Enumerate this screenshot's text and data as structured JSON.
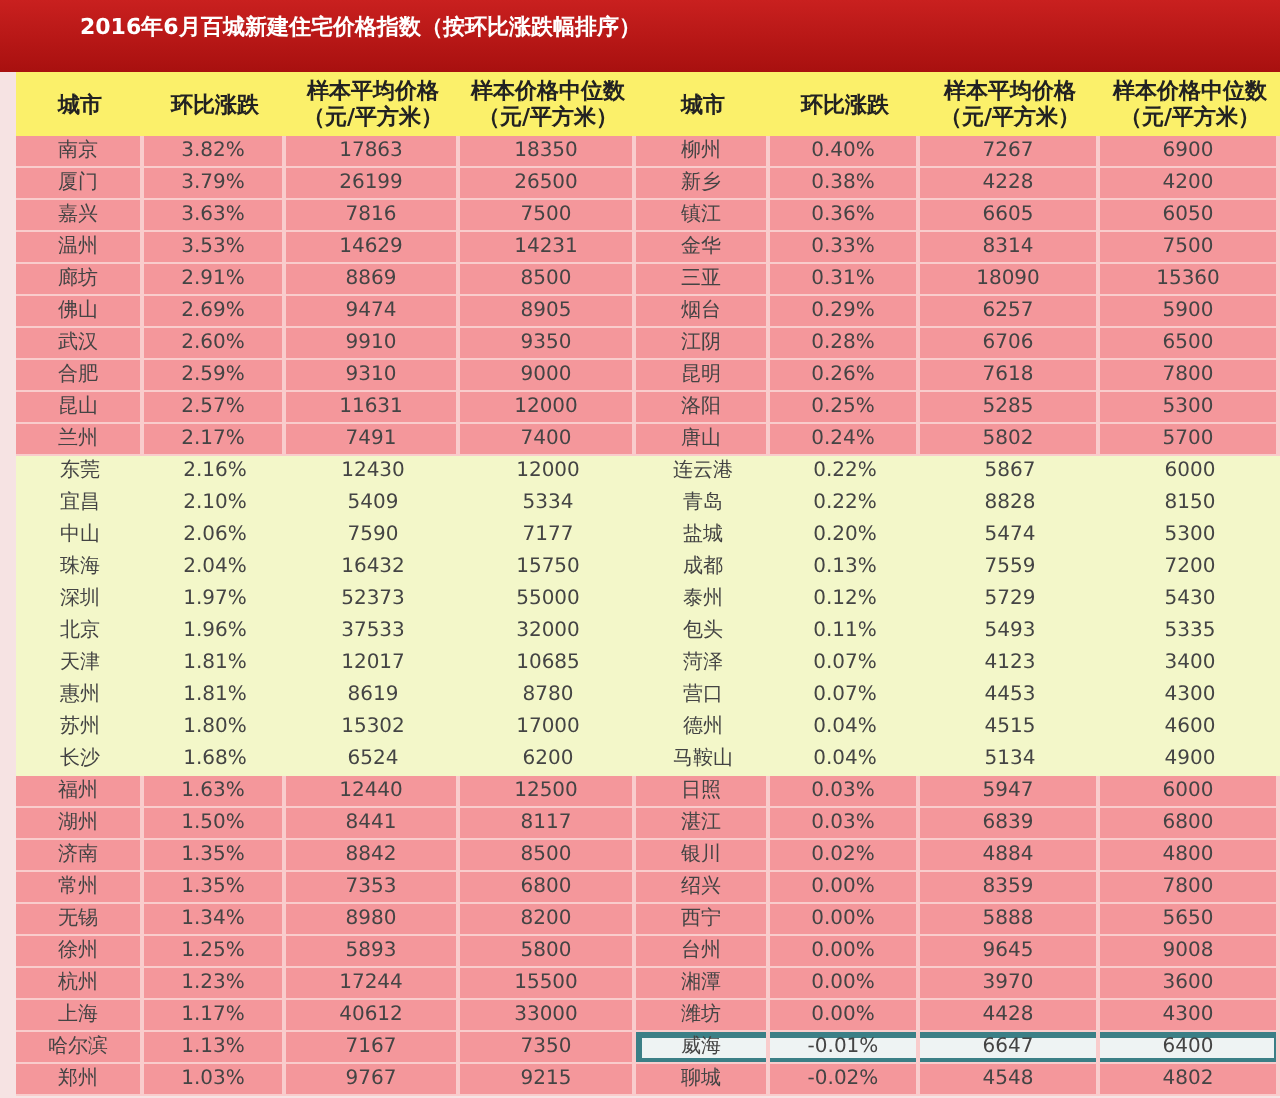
{
  "title": "2016年6月百城新建住宅价格指数（按环比涨跌幅排序）",
  "table": {
    "columns": [
      {
        "label": "城市"
      },
      {
        "label": "环比涨跌"
      },
      {
        "label": "样本平均价格",
        "unit": "（元/平方米）"
      },
      {
        "label": "样本价格中位数",
        "unit": "（元/平方米）"
      },
      {
        "label": "城市"
      },
      {
        "label": "环比涨跌"
      },
      {
        "label": "样本平均价格",
        "unit": "（元/平方米）"
      },
      {
        "label": "样本价格中位数",
        "unit": "（元/平方米）"
      }
    ],
    "rows": [
      {
        "kind": "highlight",
        "left": {
          "selected": false,
          "cells": [
            "南京",
            "3.82%",
            "17863",
            "18350"
          ]
        },
        "right": {
          "selected": false,
          "cells": [
            "柳州",
            "0.40%",
            "7267",
            "6900"
          ]
        }
      },
      {
        "kind": "highlight",
        "left": {
          "selected": false,
          "cells": [
            "厦门",
            "3.79%",
            "26199",
            "26500"
          ]
        },
        "right": {
          "selected": false,
          "cells": [
            "新乡",
            "0.38%",
            "4228",
            "4200"
          ]
        }
      },
      {
        "kind": "highlight",
        "left": {
          "selected": false,
          "cells": [
            "嘉兴",
            "3.63%",
            "7816",
            "7500"
          ]
        },
        "right": {
          "selected": false,
          "cells": [
            "镇江",
            "0.36%",
            "6605",
            "6050"
          ]
        }
      },
      {
        "kind": "highlight",
        "left": {
          "selected": false,
          "cells": [
            "温州",
            "3.53%",
            "14629",
            "14231"
          ]
        },
        "right": {
          "selected": false,
          "cells": [
            "金华",
            "0.33%",
            "8314",
            "7500"
          ]
        }
      },
      {
        "kind": "highlight",
        "left": {
          "selected": false,
          "cells": [
            "廊坊",
            "2.91%",
            "8869",
            "8500"
          ]
        },
        "right": {
          "selected": false,
          "cells": [
            "三亚",
            "0.31%",
            "18090",
            "15360"
          ]
        }
      },
      {
        "kind": "highlight",
        "left": {
          "selected": false,
          "cells": [
            "佛山",
            "2.69%",
            "9474",
            "8905"
          ]
        },
        "right": {
          "selected": false,
          "cells": [
            "烟台",
            "0.29%",
            "6257",
            "5900"
          ]
        }
      },
      {
        "kind": "highlight",
        "left": {
          "selected": false,
          "cells": [
            "武汉",
            "2.60%",
            "9910",
            "9350"
          ]
        },
        "right": {
          "selected": false,
          "cells": [
            "江阴",
            "0.28%",
            "6706",
            "6500"
          ]
        }
      },
      {
        "kind": "highlight",
        "left": {
          "selected": false,
          "cells": [
            "合肥",
            "2.59%",
            "9310",
            "9000"
          ]
        },
        "right": {
          "selected": false,
          "cells": [
            "昆明",
            "0.26%",
            "7618",
            "7800"
          ]
        }
      },
      {
        "kind": "highlight",
        "left": {
          "selected": false,
          "cells": [
            "昆山",
            "2.57%",
            "11631",
            "12000"
          ]
        },
        "right": {
          "selected": false,
          "cells": [
            "洛阳",
            "0.25%",
            "5285",
            "5300"
          ]
        }
      },
      {
        "kind": "highlight",
        "left": {
          "selected": false,
          "cells": [
            "兰州",
            "2.17%",
            "7491",
            "7400"
          ]
        },
        "right": {
          "selected": false,
          "cells": [
            "唐山",
            "0.24%",
            "5802",
            "5700"
          ]
        }
      },
      {
        "kind": "plain",
        "left": {
          "selected": false,
          "cells": [
            "东莞",
            "2.16%",
            "12430",
            "12000"
          ]
        },
        "right": {
          "selected": false,
          "cells": [
            "连云港",
            "0.22%",
            "5867",
            "6000"
          ]
        }
      },
      {
        "kind": "plain",
        "left": {
          "selected": false,
          "cells": [
            "宜昌",
            "2.10%",
            "5409",
            "5334"
          ]
        },
        "right": {
          "selected": false,
          "cells": [
            "青岛",
            "0.22%",
            "8828",
            "8150"
          ]
        }
      },
      {
        "kind": "plain",
        "left": {
          "selected": false,
          "cells": [
            "中山",
            "2.06%",
            "7590",
            "7177"
          ]
        },
        "right": {
          "selected": false,
          "cells": [
            "盐城",
            "0.20%",
            "5474",
            "5300"
          ]
        }
      },
      {
        "kind": "plain",
        "left": {
          "selected": false,
          "cells": [
            "珠海",
            "2.04%",
            "16432",
            "15750"
          ]
        },
        "right": {
          "selected": false,
          "cells": [
            "成都",
            "0.13%",
            "7559",
            "7200"
          ]
        }
      },
      {
        "kind": "plain",
        "left": {
          "selected": false,
          "cells": [
            "深圳",
            "1.97%",
            "52373",
            "55000"
          ]
        },
        "right": {
          "selected": false,
          "cells": [
            "泰州",
            "0.12%",
            "5729",
            "5430"
          ]
        }
      },
      {
        "kind": "plain",
        "left": {
          "selected": false,
          "cells": [
            "北京",
            "1.96%",
            "37533",
            "32000"
          ]
        },
        "right": {
          "selected": false,
          "cells": [
            "包头",
            "0.11%",
            "5493",
            "5335"
          ]
        }
      },
      {
        "kind": "plain",
        "left": {
          "selected": false,
          "cells": [
            "天津",
            "1.81%",
            "12017",
            "10685"
          ]
        },
        "right": {
          "selected": false,
          "cells": [
            "菏泽",
            "0.07%",
            "4123",
            "3400"
          ]
        }
      },
      {
        "kind": "plain",
        "left": {
          "selected": false,
          "cells": [
            "惠州",
            "1.81%",
            "8619",
            "8780"
          ]
        },
        "right": {
          "selected": false,
          "cells": [
            "营口",
            "0.07%",
            "4453",
            "4300"
          ]
        }
      },
      {
        "kind": "plain",
        "left": {
          "selected": false,
          "cells": [
            "苏州",
            "1.80%",
            "15302",
            "17000"
          ]
        },
        "right": {
          "selected": false,
          "cells": [
            "德州",
            "0.04%",
            "4515",
            "4600"
          ]
        }
      },
      {
        "kind": "plain",
        "left": {
          "selected": false,
          "cells": [
            "长沙",
            "1.68%",
            "6524",
            "6200"
          ]
        },
        "right": {
          "selected": false,
          "cells": [
            "马鞍山",
            "0.04%",
            "5134",
            "4900"
          ]
        }
      },
      {
        "kind": "highlight",
        "left": {
          "selected": false,
          "cells": [
            "福州",
            "1.63%",
            "12440",
            "12500"
          ]
        },
        "right": {
          "selected": false,
          "cells": [
            "日照",
            "0.03%",
            "5947",
            "6000"
          ]
        }
      },
      {
        "kind": "highlight",
        "left": {
          "selected": false,
          "cells": [
            "湖州",
            "1.50%",
            "8441",
            "8117"
          ]
        },
        "right": {
          "selected": false,
          "cells": [
            "湛江",
            "0.03%",
            "6839",
            "6800"
          ]
        }
      },
      {
        "kind": "highlight",
        "left": {
          "selected": false,
          "cells": [
            "济南",
            "1.35%",
            "8842",
            "8500"
          ]
        },
        "right": {
          "selected": false,
          "cells": [
            "银川",
            "0.02%",
            "4884",
            "4800"
          ]
        }
      },
      {
        "kind": "highlight",
        "left": {
          "selected": false,
          "cells": [
            "常州",
            "1.35%",
            "7353",
            "6800"
          ]
        },
        "right": {
          "selected": false,
          "cells": [
            "绍兴",
            "0.00%",
            "8359",
            "7800"
          ]
        }
      },
      {
        "kind": "highlight",
        "left": {
          "selected": false,
          "cells": [
            "无锡",
            "1.34%",
            "8980",
            "8200"
          ]
        },
        "right": {
          "selected": false,
          "cells": [
            "西宁",
            "0.00%",
            "5888",
            "5650"
          ]
        }
      },
      {
        "kind": "highlight",
        "left": {
          "selected": false,
          "cells": [
            "徐州",
            "1.25%",
            "5893",
            "5800"
          ]
        },
        "right": {
          "selected": false,
          "cells": [
            "台州",
            "0.00%",
            "9645",
            "9008"
          ]
        }
      },
      {
        "kind": "highlight",
        "left": {
          "selected": false,
          "cells": [
            "杭州",
            "1.23%",
            "17244",
            "15500"
          ]
        },
        "right": {
          "selected": false,
          "cells": [
            "湘潭",
            "0.00%",
            "3970",
            "3600"
          ]
        }
      },
      {
        "kind": "highlight",
        "left": {
          "selected": false,
          "cells": [
            "上海",
            "1.17%",
            "40612",
            "33000"
          ]
        },
        "right": {
          "selected": false,
          "cells": [
            "潍坊",
            "0.00%",
            "4428",
            "4300"
          ]
        }
      },
      {
        "kind": "highlight",
        "left": {
          "selected": false,
          "cells": [
            "哈尔滨",
            "1.13%",
            "7167",
            "7350"
          ]
        },
        "right": {
          "selected": true,
          "cells": [
            "威海",
            "-0.01%",
            "6647",
            "6400"
          ]
        }
      },
      {
        "kind": "highlight",
        "left": {
          "selected": false,
          "cells": [
            "郑州",
            "1.03%",
            "9767",
            "9215"
          ]
        },
        "right": {
          "selected": false,
          "cells": [
            "聊城",
            "-0.02%",
            "4548",
            "4802"
          ]
        }
      }
    ]
  }
}
